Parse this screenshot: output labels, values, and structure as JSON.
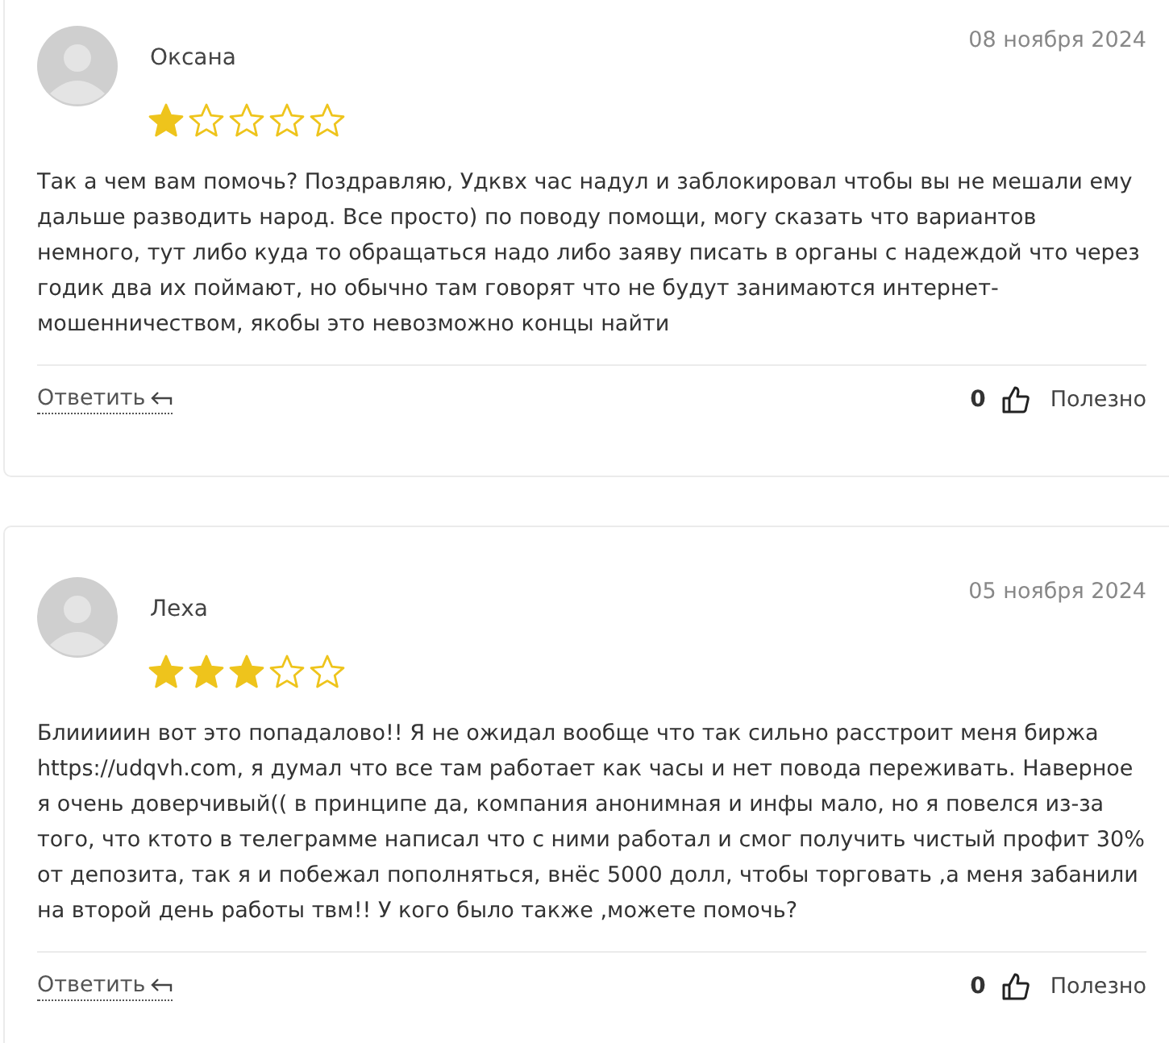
{
  "reviews": [
    {
      "author": "Оксана",
      "date": "08 ноября 2024",
      "stars": 1,
      "text": "Так а чем вам помочь? Поздравляю, Удквх час надул и заблокировал чтобы вы не мешали ему дальше разводить народ. Все просто) по поводу помощи, могу сказать что вариантов немного, тут либо куда то обращаться надо либо заяву писать в органы с надеждой что через годик два их поймают, но обычно там говорят что не будут занимаются интернет-мошенничеством, якобы это невозможно концы найти",
      "reply": "Ответить",
      "count": "0",
      "useful": "Полезно"
    },
    {
      "author": "Леха",
      "date": "05 ноября 2024",
      "stars": 3,
      "text": "Блииииин вот это попадалово!! Я не ожидал вообще что так сильно расстроит меня биржа https://udqvh.com, я думал что все там работает как часы и нет повода переживать. Наверное я очень доверчивый(( в принципе да, компания анонимная и инфы мало, но я повелся из-за того, что ктото в телеграмме написал что с ними работал и смог получить чистый профит 30% от депозита, так я и побежал пополняться, внёс 5000 долл, чтобы торговать ,а меня забанили на второй день работы твм!! У кого было также ,можете помочь?",
      "reply": "Ответить",
      "count": "0",
      "useful": "Полезно"
    }
  ]
}
